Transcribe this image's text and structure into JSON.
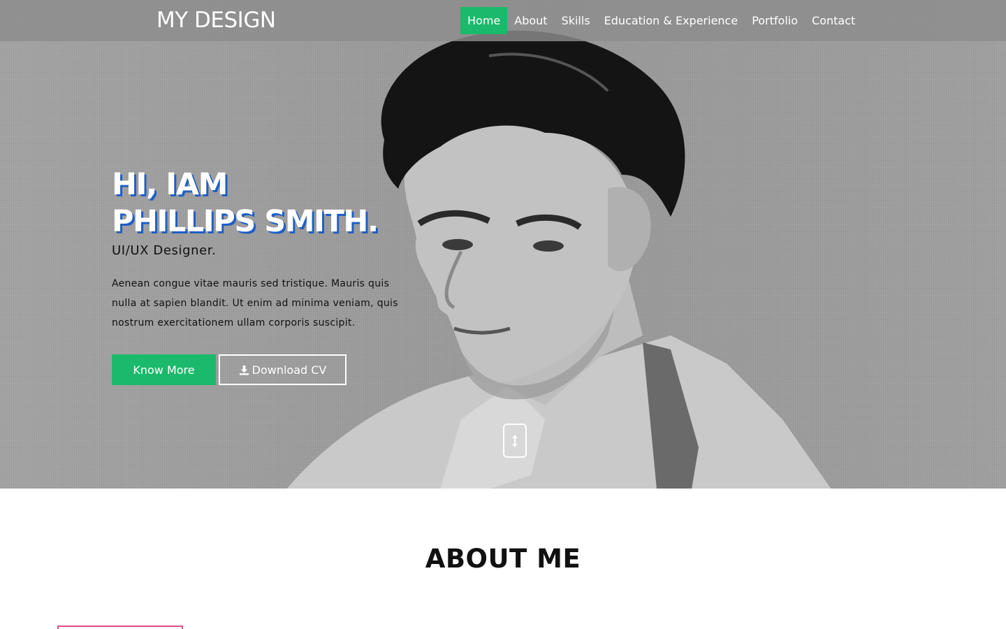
{
  "navbar": {
    "brand": "MY DESIGN",
    "items": [
      {
        "label": "Home",
        "active": true
      },
      {
        "label": "About"
      },
      {
        "label": "Skills"
      },
      {
        "label": "Education & Experience"
      },
      {
        "label": "Portfolio"
      },
      {
        "label": "Contact"
      }
    ]
  },
  "hero": {
    "title_line1": "HI, IAM",
    "title_line2": "PHILLIPS SMITH.",
    "subtitle": "UI/UX Designer.",
    "text": "Aenean congue vitae mauris sed tristique. Mauris quis nulla at sapien blandit. Ut enim ad minima veniam, quis nostrum exercitationem ullam corporis suscipit.",
    "know_more_label": "Know More",
    "download_label": "Download CV",
    "download_icon": "download-icon",
    "scroll_icon": "scroll-arrows-icon"
  },
  "about": {
    "title": "ABOUT ME"
  },
  "colors": {
    "accent": "#1bb96b",
    "title_shadow": "#1f5fc4",
    "frame_border": "#e24a87"
  }
}
